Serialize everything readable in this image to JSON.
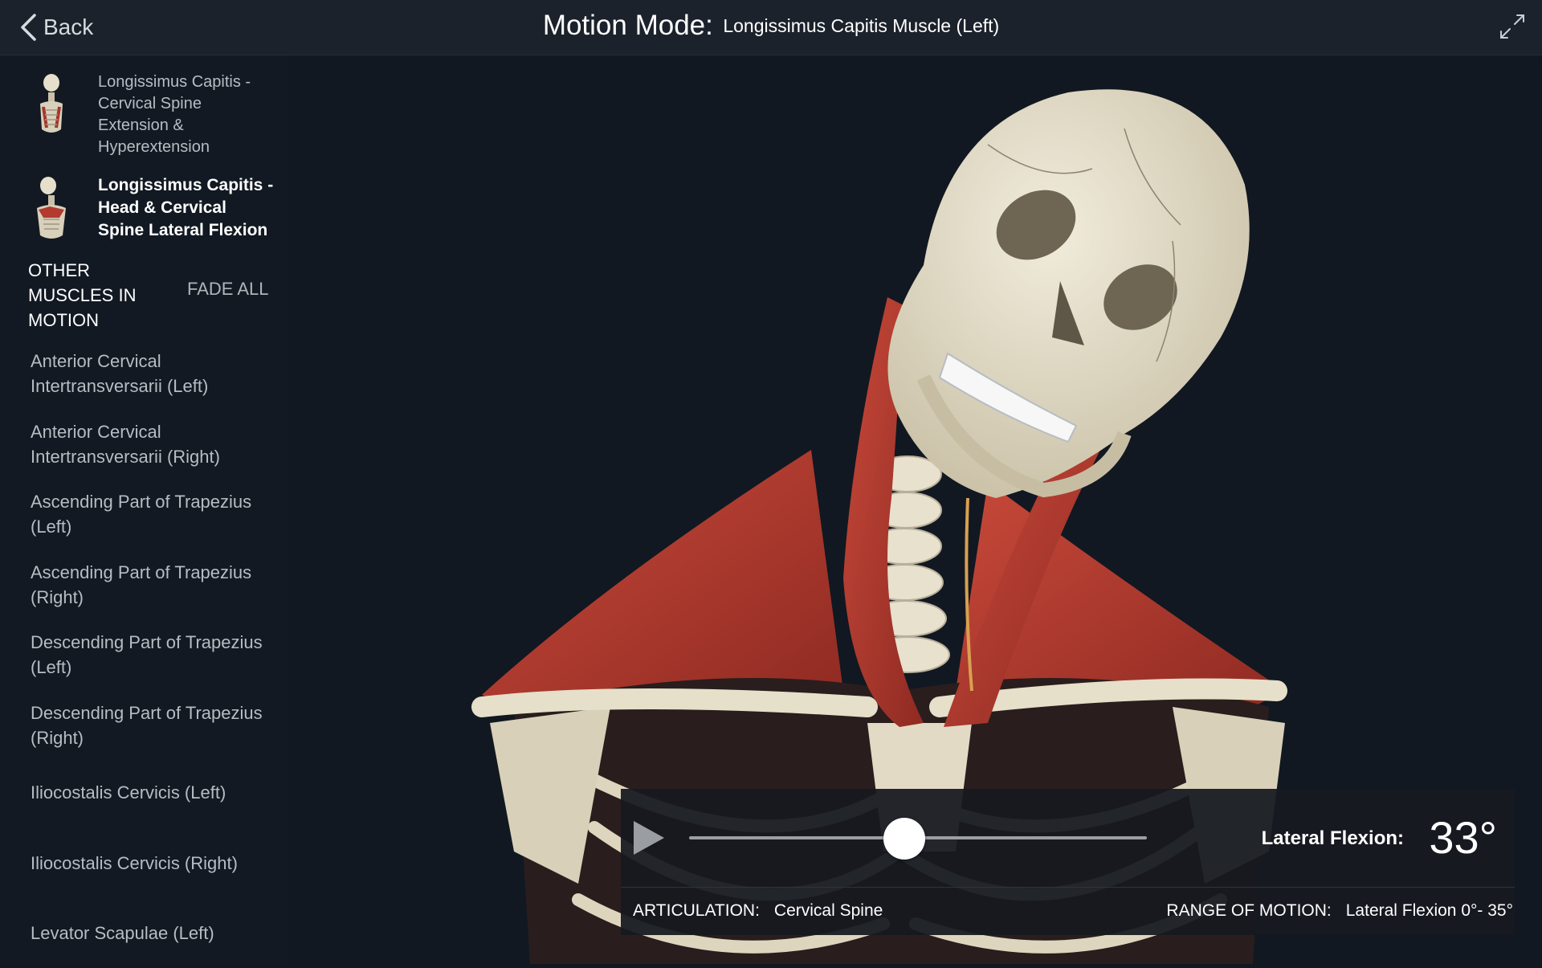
{
  "header": {
    "back_label": "Back",
    "mode_label": "Motion Mode:",
    "muscle_name": "Longissimus Capitis Muscle (Left)"
  },
  "sidebar": {
    "motions": [
      {
        "label": "Longissimus Capitis - Cervical Spine Extension & Hyperextension",
        "active": false
      },
      {
        "label": "Longissimus Capitis - Head & Cervical Spine Lateral Flexion",
        "active": true
      }
    ],
    "other_heading": "OTHER MUSCLES IN MOTION",
    "fade_all_label": "FADE ALL",
    "other_muscles": [
      "Anterior Cervical Intertransversarii (Left)",
      "Anterior Cervical Intertransversarii (Right)",
      "Ascending Part of Trapezius (Left)",
      "Ascending Part of Trapezius (Right)",
      "Descending Part of Trapezius (Left)",
      "Descending Part of Trapezius (Right)",
      "Iliocostalis Cervicis (Left)",
      "Iliocostalis Cervicis (Right)",
      "Levator Scapulae (Left)"
    ]
  },
  "motion_panel": {
    "slider_fraction": 0.47,
    "motion_label": "Lateral Flexion:",
    "motion_value": "33°",
    "articulation_label": "ARTICULATION:",
    "articulation_value": "Cervical Spine",
    "range_label": "RANGE OF MOTION:",
    "range_value": "Lateral Flexion 0°- 35°"
  },
  "colors": {
    "background": "#111821",
    "topbar": "#1b222b",
    "muscle": "#b23a2e",
    "bone": "#e3dcc8"
  }
}
